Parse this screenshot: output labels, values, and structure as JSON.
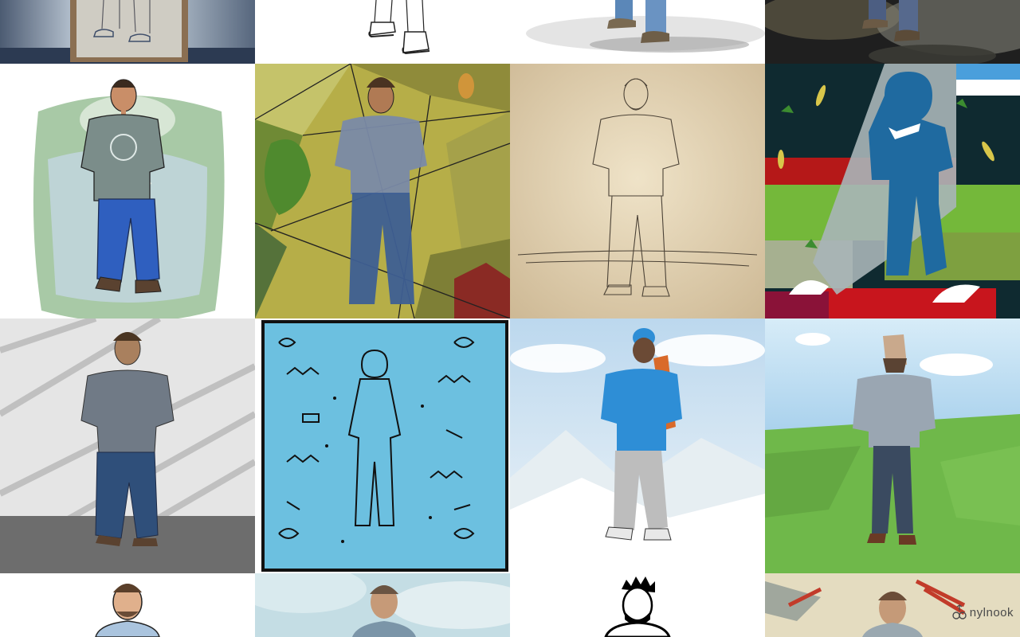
{
  "gallery": {
    "description_rows": 4,
    "columns": 4,
    "tiles": [
      {
        "style": "sketch-on-paper-photo",
        "palette": [
          "#5a6a80",
          "#c9c6bd",
          "#7a6a55"
        ]
      },
      {
        "style": "ink-line-art",
        "palette": [
          "#ffffff",
          "#222222"
        ]
      },
      {
        "style": "watercolor-wash-feet",
        "palette": [
          "#f2f2f2",
          "#5b87b8",
          "#8a7a60"
        ]
      },
      {
        "style": "dark-smoke",
        "palette": [
          "#1e1e1e",
          "#5a6a85",
          "#6b5a45"
        ]
      },
      {
        "style": "watercolor-sketch",
        "palette": [
          "#8fbf8a",
          "#7b8c8a",
          "#2f5fbf"
        ]
      },
      {
        "style": "stained-glass",
        "palette": [
          "#b8b04a",
          "#4e6a8f",
          "#6a8a2a"
        ]
      },
      {
        "style": "pencil-on-parchment",
        "palette": [
          "#e2d3b4",
          "#5c5142"
        ]
      },
      {
        "style": "flat-cutout",
        "palette": [
          "#0f2a30",
          "#1f6aa0",
          "#b51a1a",
          "#74b83a"
        ]
      },
      {
        "style": "charcoal-streaks",
        "palette": [
          "#e9e9e9",
          "#707a86",
          "#2f4f7a"
        ]
      },
      {
        "style": "doodle-pattern",
        "palette": [
          "#6cc0e0",
          "#111111"
        ]
      },
      {
        "style": "mountain-painting",
        "palette": [
          "#cfe3f2",
          "#2e8ed6",
          "#bdbdbd"
        ]
      },
      {
        "style": "low-poly-3d",
        "palette": [
          "#bfe0f2",
          "#6fb84a",
          "#8a9aa8"
        ]
      },
      {
        "style": "comic-line",
        "palette": [
          "#ffffff",
          "#aac4de",
          "#222222"
        ]
      },
      {
        "style": "soft-watercolor",
        "palette": [
          "#b6d3dc",
          "#7b95a8"
        ]
      },
      {
        "style": "bold-ink",
        "palette": [
          "#ffffff",
          "#000000"
        ]
      },
      {
        "style": "expressive-brush",
        "palette": [
          "#e8dfc4",
          "#c23b2a",
          "#8a9aa0"
        ]
      }
    ]
  },
  "watermark": {
    "text": "nylnook",
    "color": "#4a4a4a"
  }
}
